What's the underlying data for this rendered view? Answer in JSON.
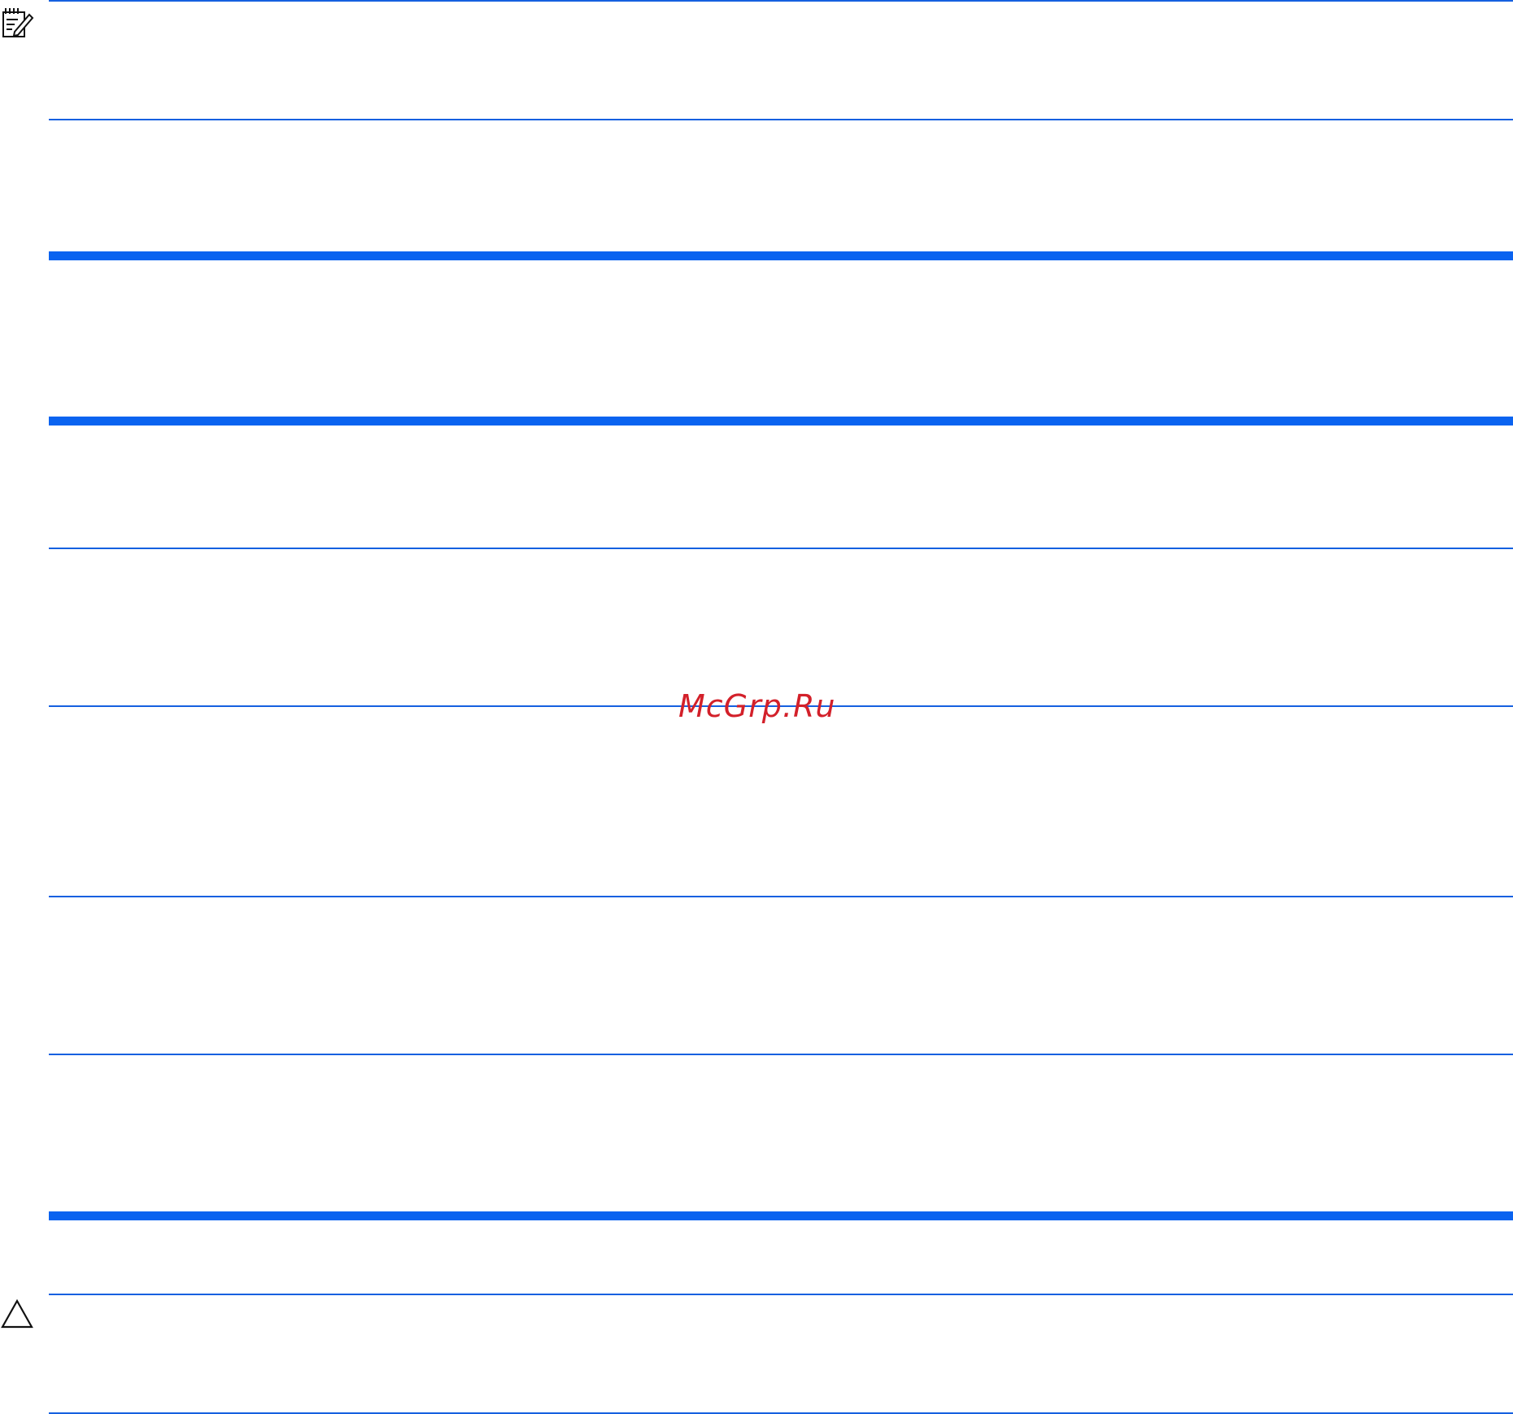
{
  "page": {
    "watermark": "McGrp.Ru"
  },
  "icons": {
    "note": "note-pencil-icon",
    "caution": "caution-triangle-icon"
  },
  "colors": {
    "rule": "#1560e0",
    "thick_rule": "#0a63f0",
    "watermark": "#d3202a"
  }
}
